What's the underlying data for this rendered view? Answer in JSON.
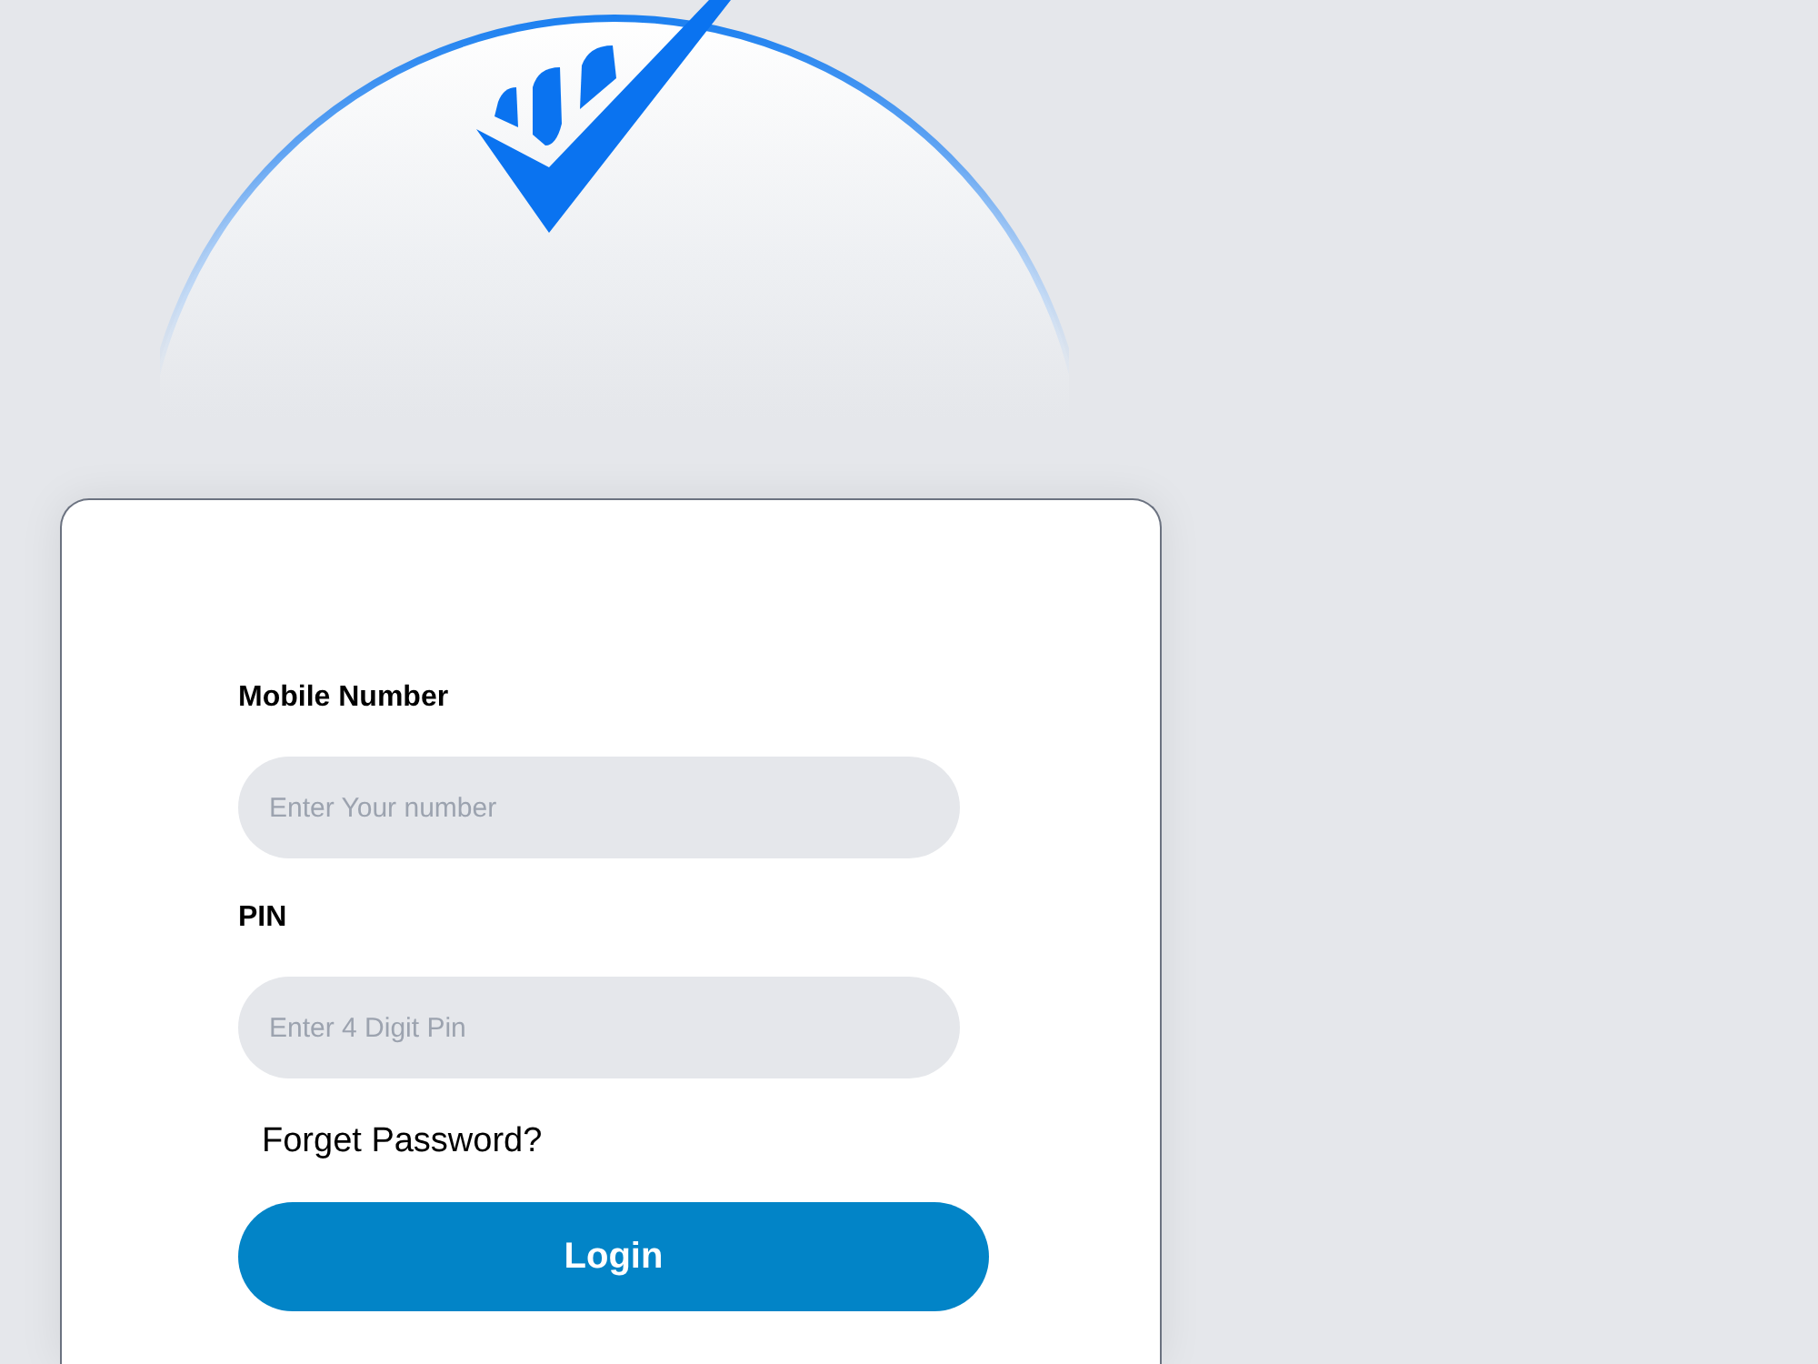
{
  "form": {
    "fields": [
      {
        "label": "Mobile Number",
        "placeholder": "Enter Your number"
      },
      {
        "label": "PIN",
        "placeholder": "Enter 4 Digit Pin"
      }
    ],
    "link": "Forget Password?",
    "button": "Login"
  }
}
